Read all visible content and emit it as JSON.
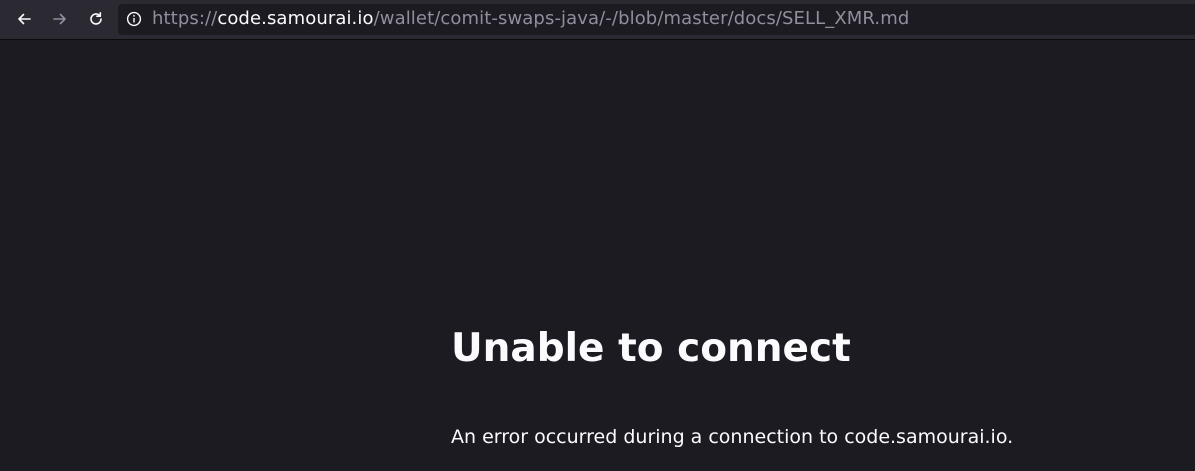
{
  "toolbar": {
    "back_icon": "arrow-left-icon",
    "forward_icon": "arrow-right-icon",
    "reload_icon": "reload-icon"
  },
  "urlbar": {
    "scheme": "https://",
    "host": "code.samourai.io",
    "path": "/wallet/comit-swaps-java/-/blob/master/docs/SELL_XMR.md",
    "info_icon": "info-icon"
  },
  "error": {
    "title": "Unable to connect",
    "description": "An error occurred during a connection to code.samourai.io."
  },
  "colors": {
    "toolbar_bg": "#2b2a33",
    "page_bg": "#1c1b22",
    "text": "#fbfbfe",
    "url_dim": "#8f8f9d"
  }
}
